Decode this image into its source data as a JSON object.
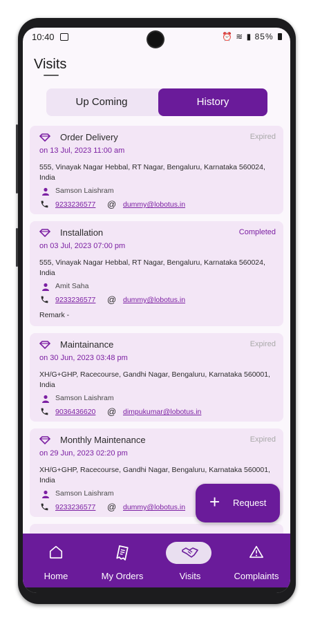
{
  "status_bar": {
    "time": "10:40",
    "battery": "85%"
  },
  "header": {
    "title": "Visits"
  },
  "tabs": [
    {
      "label": "Up Coming",
      "active": false
    },
    {
      "label": "History",
      "active": true
    }
  ],
  "visits": [
    {
      "title": "Order Delivery",
      "status": "Expired",
      "date": "on 13 Jul, 2023 11:00 am",
      "address": "555, Vinayak Nagar Hebbal, RT Nagar, Bengaluru, Karnataka 560024, India",
      "person": "Samson Laishram",
      "phone": "9233236577",
      "email": "dummy@lobotus.in"
    },
    {
      "title": "Installation",
      "status": "Completed",
      "date": "on 03 Jul, 2023 07:00 pm",
      "address": "555, Vinayak Nagar Hebbal, RT Nagar, Bengaluru, Karnataka 560024, India",
      "person": "Amit Saha",
      "phone": "9233236577",
      "email": "dummy@lobotus.in",
      "remark": "Remark -"
    },
    {
      "title": "Maintainance",
      "status": "Expired",
      "date": "on 30 Jun, 2023 03:48 pm",
      "address": "XH/G+GHP, Racecourse, Gandhi Nagar, Bengaluru, Karnataka 560001, India",
      "person": "Samson Laishram",
      "phone": "9036436620",
      "email": "dimpukumar@lobotus.in"
    },
    {
      "title": "Monthly Maintenance",
      "status": "Expired",
      "date": "on 29 Jun, 2023 02:20 pm",
      "address": "XH/G+GHP, Racecourse, Gandhi Nagar, Bengaluru, Karnataka 560001, India",
      "person": "Samson Laishram",
      "phone": "9233236577",
      "email": "dummy@lobotus.in"
    }
  ],
  "at_symbol": "@",
  "fab": {
    "plus": "+",
    "label": "Request"
  },
  "nav": [
    {
      "label": "Home",
      "icon": "home-icon"
    },
    {
      "label": "My Orders",
      "icon": "receipt-icon"
    },
    {
      "label": "Visits",
      "icon": "handshake-icon",
      "active": true
    },
    {
      "label": "Complaints",
      "icon": "warning-icon"
    }
  ],
  "colors": {
    "primary": "#6a1b9a",
    "card_bg": "#f3e6f6",
    "status_expired": "#a9a9a9",
    "status_completed": "#7b1fa2"
  }
}
